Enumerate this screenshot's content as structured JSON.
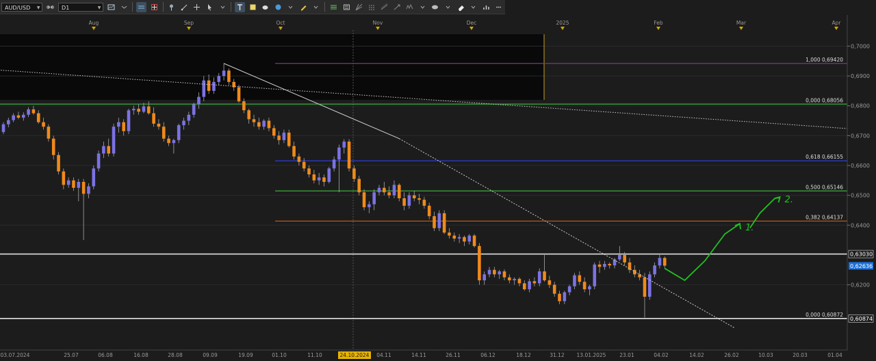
{
  "toolbar": {
    "symbol": "AUD/USD",
    "timeframe": "D1",
    "buttons": [
      "chart-type-icon",
      "crosshair-icon",
      "line-tool-icon",
      "pin-icon",
      "text-tool-icon",
      "note-icon",
      "shape-icon",
      "circle-icon",
      "pencil-icon",
      "fibonacci-icon",
      "channel-icon",
      "gann-icon",
      "arrow-icon",
      "eraser-icon",
      "indicators-icon",
      "more-icon"
    ]
  },
  "colors": {
    "background": "#1c1c1c",
    "bull": "#7b72e4",
    "bear": "#f08a1a",
    "grid": "#2a2a2a",
    "axis_text": "#9a9a9a",
    "current_price_bg": "#1e6fd6"
  },
  "chart_data": {
    "type": "candlestick",
    "symbol": "AUD/USD",
    "timeframe": "D1",
    "ylim": [
      0.605,
      0.704
    ],
    "y_ticks": [
      "0,7000",
      "0,6900",
      "0,6800",
      "0,6700",
      "0,6600",
      "0,6500",
      "0,6400",
      "0,6200"
    ],
    "top_axis_labels": [
      "Aug",
      "Sep",
      "Oct",
      "Nov",
      "Dec",
      "2025",
      "Feb",
      "Mar",
      "Apr"
    ],
    "bottom_axis_labels": [
      "03.07.2024",
      "25.07",
      "06.08",
      "16.08",
      "28.08",
      "09.09",
      "19.09",
      "01.10",
      "11.10",
      "24.10.2024",
      "04.11",
      "14.11",
      "26.11",
      "06.12",
      "18.12",
      "31.12",
      "13.01.2025",
      "23.01",
      "04.02",
      "14.02",
      "26.02",
      "10.03",
      "20.03",
      "01.04"
    ],
    "highlighted_date": "24.10.2024",
    "current_price": "0,62636",
    "fibonacci_levels": [
      {
        "label": "1,000 0,69420",
        "value": 0.6942,
        "color": "#7a3a7a"
      },
      {
        "label": "0,000 0,68056",
        "value": 0.68056,
        "color": "#3fae3f"
      },
      {
        "label": "0,618 0,66155",
        "value": 0.66155,
        "color": "#2f3fd6"
      },
      {
        "label": "0,500 0,65146",
        "value": 0.65146,
        "color": "#3fae3f"
      },
      {
        "label": "0,382 0,64137",
        "value": 0.64137,
        "color": "#c8601c"
      }
    ],
    "horizontal_lines": [
      {
        "label": "0,63030",
        "value": 0.6303,
        "color": "#e0e0e0"
      },
      {
        "label": "0,000 0,60872",
        "value": 0.60872,
        "color": "#e0e0e0",
        "axis_label": "0,60874"
      }
    ],
    "annotations": [
      "1.",
      "2."
    ],
    "candles": [
      {
        "x": 0,
        "o": 0.6712,
        "h": 0.6745,
        "l": 0.6705,
        "c": 0.6738
      },
      {
        "x": 1,
        "o": 0.6738,
        "h": 0.676,
        "l": 0.6728,
        "c": 0.6752
      },
      {
        "x": 2,
        "o": 0.6752,
        "h": 0.6775,
        "l": 0.6745,
        "c": 0.6768
      },
      {
        "x": 3,
        "o": 0.6768,
        "h": 0.678,
        "l": 0.6755,
        "c": 0.676
      },
      {
        "x": 4,
        "o": 0.676,
        "h": 0.6778,
        "l": 0.675,
        "c": 0.677
      },
      {
        "x": 5,
        "o": 0.677,
        "h": 0.6795,
        "l": 0.6762,
        "c": 0.6788
      },
      {
        "x": 6,
        "o": 0.6788,
        "h": 0.68,
        "l": 0.677,
        "c": 0.6775
      },
      {
        "x": 7,
        "o": 0.6775,
        "h": 0.6785,
        "l": 0.674,
        "c": 0.6745
      },
      {
        "x": 8,
        "o": 0.6745,
        "h": 0.676,
        "l": 0.672,
        "c": 0.673
      },
      {
        "x": 9,
        "o": 0.673,
        "h": 0.6738,
        "l": 0.668,
        "c": 0.669
      },
      {
        "x": 10,
        "o": 0.669,
        "h": 0.67,
        "l": 0.662,
        "c": 0.6635
      },
      {
        "x": 11,
        "o": 0.6635,
        "h": 0.6645,
        "l": 0.657,
        "c": 0.658
      },
      {
        "x": 12,
        "o": 0.658,
        "h": 0.659,
        "l": 0.652,
        "c": 0.6535
      },
      {
        "x": 13,
        "o": 0.6535,
        "h": 0.656,
        "l": 0.6525,
        "c": 0.655
      },
      {
        "x": 14,
        "o": 0.655,
        "h": 0.656,
        "l": 0.6515,
        "c": 0.6525
      },
      {
        "x": 15,
        "o": 0.6525,
        "h": 0.6555,
        "l": 0.648,
        "c": 0.6545
      },
      {
        "x": 16,
        "o": 0.6545,
        "h": 0.6555,
        "l": 0.635,
        "c": 0.6505
      },
      {
        "x": 17,
        "o": 0.6505,
        "h": 0.654,
        "l": 0.649,
        "c": 0.653
      },
      {
        "x": 18,
        "o": 0.653,
        "h": 0.66,
        "l": 0.652,
        "c": 0.659
      },
      {
        "x": 19,
        "o": 0.659,
        "h": 0.665,
        "l": 0.658,
        "c": 0.664
      },
      {
        "x": 20,
        "o": 0.664,
        "h": 0.668,
        "l": 0.6625,
        "c": 0.6665
      },
      {
        "x": 21,
        "o": 0.6665,
        "h": 0.669,
        "l": 0.663,
        "c": 0.664
      },
      {
        "x": 22,
        "o": 0.664,
        "h": 0.674,
        "l": 0.663,
        "c": 0.673
      },
      {
        "x": 23,
        "o": 0.673,
        "h": 0.676,
        "l": 0.671,
        "c": 0.6745
      },
      {
        "x": 24,
        "o": 0.6745,
        "h": 0.6755,
        "l": 0.67,
        "c": 0.6715
      },
      {
        "x": 25,
        "o": 0.6715,
        "h": 0.679,
        "l": 0.6705,
        "c": 0.6785
      },
      {
        "x": 26,
        "o": 0.6785,
        "h": 0.68,
        "l": 0.677,
        "c": 0.679
      },
      {
        "x": 27,
        "o": 0.679,
        "h": 0.6805,
        "l": 0.677,
        "c": 0.678
      },
      {
        "x": 28,
        "o": 0.678,
        "h": 0.681,
        "l": 0.6775,
        "c": 0.6798
      },
      {
        "x": 29,
        "o": 0.6798,
        "h": 0.6815,
        "l": 0.677,
        "c": 0.6775
      },
      {
        "x": 30,
        "o": 0.6775,
        "h": 0.6795,
        "l": 0.673,
        "c": 0.674
      },
      {
        "x": 31,
        "o": 0.674,
        "h": 0.6755,
        "l": 0.672,
        "c": 0.673
      },
      {
        "x": 32,
        "o": 0.673,
        "h": 0.6745,
        "l": 0.668,
        "c": 0.669
      },
      {
        "x": 33,
        "o": 0.669,
        "h": 0.67,
        "l": 0.6665,
        "c": 0.6675
      },
      {
        "x": 34,
        "o": 0.6675,
        "h": 0.669,
        "l": 0.664,
        "c": 0.6685
      },
      {
        "x": 35,
        "o": 0.6685,
        "h": 0.674,
        "l": 0.6675,
        "c": 0.6735
      },
      {
        "x": 36,
        "o": 0.6735,
        "h": 0.676,
        "l": 0.672,
        "c": 0.675
      },
      {
        "x": 37,
        "o": 0.675,
        "h": 0.678,
        "l": 0.6735,
        "c": 0.677
      },
      {
        "x": 38,
        "o": 0.677,
        "h": 0.681,
        "l": 0.676,
        "c": 0.6805
      },
      {
        "x": 39,
        "o": 0.6805,
        "h": 0.6845,
        "l": 0.679,
        "c": 0.683
      },
      {
        "x": 40,
        "o": 0.683,
        "h": 0.69,
        "l": 0.6815,
        "c": 0.6885
      },
      {
        "x": 41,
        "o": 0.6885,
        "h": 0.6905,
        "l": 0.684,
        "c": 0.685
      },
      {
        "x": 42,
        "o": 0.685,
        "h": 0.6895,
        "l": 0.684,
        "c": 0.688
      },
      {
        "x": 43,
        "o": 0.688,
        "h": 0.691,
        "l": 0.687,
        "c": 0.69
      },
      {
        "x": 44,
        "o": 0.69,
        "h": 0.6942,
        "l": 0.6885,
        "c": 0.6918
      },
      {
        "x": 45,
        "o": 0.6918,
        "h": 0.6925,
        "l": 0.687,
        "c": 0.688
      },
      {
        "x": 46,
        "o": 0.688,
        "h": 0.689,
        "l": 0.685,
        "c": 0.6862
      },
      {
        "x": 47,
        "o": 0.6862,
        "h": 0.687,
        "l": 0.681,
        "c": 0.6815
      },
      {
        "x": 48,
        "o": 0.6815,
        "h": 0.6825,
        "l": 0.6775,
        "c": 0.6785
      },
      {
        "x": 49,
        "o": 0.6785,
        "h": 0.679,
        "l": 0.674,
        "c": 0.6755
      },
      {
        "x": 50,
        "o": 0.6755,
        "h": 0.677,
        "l": 0.673,
        "c": 0.6745
      },
      {
        "x": 51,
        "o": 0.6745,
        "h": 0.676,
        "l": 0.672,
        "c": 0.673
      },
      {
        "x": 52,
        "o": 0.673,
        "h": 0.6755,
        "l": 0.672,
        "c": 0.675
      },
      {
        "x": 53,
        "o": 0.675,
        "h": 0.676,
        "l": 0.6715,
        "c": 0.6725
      },
      {
        "x": 54,
        "o": 0.6725,
        "h": 0.6735,
        "l": 0.669,
        "c": 0.67
      },
      {
        "x": 55,
        "o": 0.67,
        "h": 0.6715,
        "l": 0.667,
        "c": 0.6685
      },
      {
        "x": 56,
        "o": 0.6685,
        "h": 0.672,
        "l": 0.6675,
        "c": 0.671
      },
      {
        "x": 57,
        "o": 0.671,
        "h": 0.672,
        "l": 0.666,
        "c": 0.6665
      },
      {
        "x": 58,
        "o": 0.6665,
        "h": 0.668,
        "l": 0.662,
        "c": 0.663
      },
      {
        "x": 59,
        "o": 0.663,
        "h": 0.664,
        "l": 0.66,
        "c": 0.6612
      },
      {
        "x": 60,
        "o": 0.6612,
        "h": 0.6625,
        "l": 0.658,
        "c": 0.659
      },
      {
        "x": 61,
        "o": 0.659,
        "h": 0.66,
        "l": 0.656,
        "c": 0.657
      },
      {
        "x": 62,
        "o": 0.657,
        "h": 0.6585,
        "l": 0.654,
        "c": 0.655
      },
      {
        "x": 63,
        "o": 0.655,
        "h": 0.6575,
        "l": 0.6535,
        "c": 0.656
      },
      {
        "x": 64,
        "o": 0.656,
        "h": 0.657,
        "l": 0.653,
        "c": 0.6545
      },
      {
        "x": 65,
        "o": 0.6545,
        "h": 0.6595,
        "l": 0.654,
        "c": 0.659
      },
      {
        "x": 66,
        "o": 0.659,
        "h": 0.663,
        "l": 0.658,
        "c": 0.662
      },
      {
        "x": 67,
        "o": 0.662,
        "h": 0.667,
        "l": 0.651,
        "c": 0.666
      },
      {
        "x": 68,
        "o": 0.666,
        "h": 0.6688,
        "l": 0.664,
        "c": 0.668
      },
      {
        "x": 69,
        "o": 0.668,
        "h": 0.6688,
        "l": 0.658,
        "c": 0.659
      },
      {
        "x": 70,
        "o": 0.659,
        "h": 0.66,
        "l": 0.6545,
        "c": 0.6555
      },
      {
        "x": 71,
        "o": 0.6555,
        "h": 0.6565,
        "l": 0.65,
        "c": 0.651
      },
      {
        "x": 72,
        "o": 0.651,
        "h": 0.652,
        "l": 0.645,
        "c": 0.646
      },
      {
        "x": 73,
        "o": 0.646,
        "h": 0.648,
        "l": 0.644,
        "c": 0.647
      },
      {
        "x": 74,
        "o": 0.647,
        "h": 0.652,
        "l": 0.645,
        "c": 0.651
      },
      {
        "x": 75,
        "o": 0.651,
        "h": 0.6535,
        "l": 0.65,
        "c": 0.6525
      },
      {
        "x": 76,
        "o": 0.6525,
        "h": 0.6545,
        "l": 0.65,
        "c": 0.651
      },
      {
        "x": 77,
        "o": 0.651,
        "h": 0.653,
        "l": 0.649,
        "c": 0.65
      },
      {
        "x": 78,
        "o": 0.65,
        "h": 0.655,
        "l": 0.649,
        "c": 0.6535
      },
      {
        "x": 79,
        "o": 0.6535,
        "h": 0.654,
        "l": 0.648,
        "c": 0.649
      },
      {
        "x": 80,
        "o": 0.649,
        "h": 0.651,
        "l": 0.645,
        "c": 0.6465
      },
      {
        "x": 81,
        "o": 0.6465,
        "h": 0.651,
        "l": 0.6455,
        "c": 0.65
      },
      {
        "x": 82,
        "o": 0.65,
        "h": 0.6515,
        "l": 0.648,
        "c": 0.649
      },
      {
        "x": 83,
        "o": 0.649,
        "h": 0.6505,
        "l": 0.647,
        "c": 0.6485
      },
      {
        "x": 84,
        "o": 0.6485,
        "h": 0.6495,
        "l": 0.6455,
        "c": 0.6465
      },
      {
        "x": 85,
        "o": 0.6465,
        "h": 0.6475,
        "l": 0.642,
        "c": 0.643
      },
      {
        "x": 86,
        "o": 0.643,
        "h": 0.6445,
        "l": 0.638,
        "c": 0.639
      },
      {
        "x": 87,
        "o": 0.639,
        "h": 0.645,
        "l": 0.638,
        "c": 0.644
      },
      {
        "x": 88,
        "o": 0.644,
        "h": 0.645,
        "l": 0.637,
        "c": 0.6375
      },
      {
        "x": 89,
        "o": 0.6375,
        "h": 0.639,
        "l": 0.6355,
        "c": 0.6365
      },
      {
        "x": 90,
        "o": 0.6365,
        "h": 0.6375,
        "l": 0.6345,
        "c": 0.6355
      },
      {
        "x": 91,
        "o": 0.6355,
        "h": 0.637,
        "l": 0.634,
        "c": 0.636
      },
      {
        "x": 92,
        "o": 0.636,
        "h": 0.6365,
        "l": 0.633,
        "c": 0.6345
      },
      {
        "x": 93,
        "o": 0.6345,
        "h": 0.637,
        "l": 0.6335,
        "c": 0.6365
      },
      {
        "x": 94,
        "o": 0.6365,
        "h": 0.637,
        "l": 0.6325,
        "c": 0.633
      },
      {
        "x": 95,
        "o": 0.633,
        "h": 0.634,
        "l": 0.62,
        "c": 0.6215
      },
      {
        "x": 96,
        "o": 0.6215,
        "h": 0.6245,
        "l": 0.62,
        "c": 0.6235
      },
      {
        "x": 97,
        "o": 0.6235,
        "h": 0.626,
        "l": 0.6225,
        "c": 0.625
      },
      {
        "x": 98,
        "o": 0.625,
        "h": 0.626,
        "l": 0.6225,
        "c": 0.6235
      },
      {
        "x": 99,
        "o": 0.6235,
        "h": 0.625,
        "l": 0.622,
        "c": 0.6245
      },
      {
        "x": 100,
        "o": 0.6245,
        "h": 0.6252,
        "l": 0.6215,
        "c": 0.6225
      },
      {
        "x": 101,
        "o": 0.6225,
        "h": 0.6235,
        "l": 0.6205,
        "c": 0.6215
      },
      {
        "x": 102,
        "o": 0.6215,
        "h": 0.6225,
        "l": 0.62,
        "c": 0.622
      },
      {
        "x": 103,
        "o": 0.622,
        "h": 0.6225,
        "l": 0.6195,
        "c": 0.6205
      },
      {
        "x": 104,
        "o": 0.6205,
        "h": 0.6215,
        "l": 0.618,
        "c": 0.6185
      },
      {
        "x": 105,
        "o": 0.6185,
        "h": 0.622,
        "l": 0.6175,
        "c": 0.6212
      },
      {
        "x": 106,
        "o": 0.6212,
        "h": 0.6225,
        "l": 0.6195,
        "c": 0.6205
      },
      {
        "x": 107,
        "o": 0.6205,
        "h": 0.6255,
        "l": 0.6195,
        "c": 0.6245
      },
      {
        "x": 108,
        "o": 0.6245,
        "h": 0.63,
        "l": 0.621,
        "c": 0.6215
      },
      {
        "x": 109,
        "o": 0.6215,
        "h": 0.623,
        "l": 0.619,
        "c": 0.62
      },
      {
        "x": 110,
        "o": 0.62,
        "h": 0.621,
        "l": 0.616,
        "c": 0.617
      },
      {
        "x": 111,
        "o": 0.617,
        "h": 0.618,
        "l": 0.6135,
        "c": 0.6145
      },
      {
        "x": 112,
        "o": 0.6145,
        "h": 0.618,
        "l": 0.6135,
        "c": 0.6175
      },
      {
        "x": 113,
        "o": 0.6175,
        "h": 0.62,
        "l": 0.6165,
        "c": 0.6195
      },
      {
        "x": 114,
        "o": 0.6195,
        "h": 0.624,
        "l": 0.6185,
        "c": 0.6232
      },
      {
        "x": 115,
        "o": 0.6232,
        "h": 0.6245,
        "l": 0.62,
        "c": 0.621
      },
      {
        "x": 116,
        "o": 0.621,
        "h": 0.6225,
        "l": 0.6175,
        "c": 0.6185
      },
      {
        "x": 117,
        "o": 0.6185,
        "h": 0.62,
        "l": 0.6165,
        "c": 0.6195
      },
      {
        "x": 118,
        "o": 0.6195,
        "h": 0.6275,
        "l": 0.6185,
        "c": 0.6268
      },
      {
        "x": 119,
        "o": 0.6268,
        "h": 0.628,
        "l": 0.624,
        "c": 0.626
      },
      {
        "x": 120,
        "o": 0.626,
        "h": 0.628,
        "l": 0.625,
        "c": 0.627
      },
      {
        "x": 121,
        "o": 0.627,
        "h": 0.6275,
        "l": 0.6255,
        "c": 0.6265
      },
      {
        "x": 122,
        "o": 0.6265,
        "h": 0.629,
        "l": 0.6255,
        "c": 0.6285
      },
      {
        "x": 123,
        "o": 0.6285,
        "h": 0.633,
        "l": 0.628,
        "c": 0.63
      },
      {
        "x": 124,
        "o": 0.63,
        "h": 0.631,
        "l": 0.6265,
        "c": 0.6275
      },
      {
        "x": 125,
        "o": 0.6275,
        "h": 0.629,
        "l": 0.624,
        "c": 0.625
      },
      {
        "x": 126,
        "o": 0.625,
        "h": 0.6265,
        "l": 0.6225,
        "c": 0.6235
      },
      {
        "x": 127,
        "o": 0.6235,
        "h": 0.625,
        "l": 0.6215,
        "c": 0.6225
      },
      {
        "x": 128,
        "o": 0.6225,
        "h": 0.624,
        "l": 0.609,
        "c": 0.616
      },
      {
        "x": 129,
        "o": 0.616,
        "h": 0.6245,
        "l": 0.615,
        "c": 0.6235
      },
      {
        "x": 130,
        "o": 0.6235,
        "h": 0.6275,
        "l": 0.6225,
        "c": 0.6265
      },
      {
        "x": 131,
        "o": 0.6265,
        "h": 0.63,
        "l": 0.6255,
        "c": 0.629
      },
      {
        "x": 132,
        "o": 0.629,
        "h": 0.6295,
        "l": 0.6255,
        "c": 0.6264
      }
    ],
    "trend_lines": [
      {
        "from": {
          "x": -1,
          "y": 0.692
        },
        "to": {
          "x": 176,
          "y": 0.6715
        },
        "color": "#cfcfcf",
        "style": "dotted"
      },
      {
        "from": {
          "x": 44,
          "y": 0.6942
        },
        "to": {
          "x": 79,
          "y": 0.669
        },
        "color": "#cfcfcf",
        "style": "solid"
      },
      {
        "from": {
          "x": 79,
          "y": 0.669
        },
        "to": {
          "x": 146,
          "y": 0.6055
        },
        "color": "#cfcfcf",
        "style": "dashed"
      }
    ],
    "forecast_path": [
      {
        "x": 132,
        "y": 0.6255
      },
      {
        "x": 136,
        "y": 0.6215
      },
      {
        "x": 140,
        "y": 0.628
      },
      {
        "x": 144,
        "y": 0.637
      },
      {
        "x": 147,
        "y": 0.6405
      },
      {
        "x": 149,
        "y": 0.639
      },
      {
        "x": 151,
        "y": 0.644
      },
      {
        "x": 154,
        "y": 0.649
      },
      {
        "x": 155,
        "y": 0.6492
      }
    ]
  }
}
